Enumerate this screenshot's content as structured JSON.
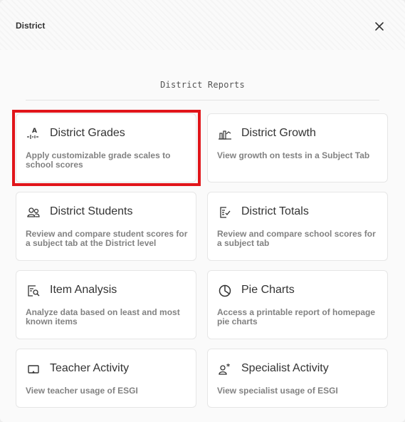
{
  "header": {
    "title": "District"
  },
  "section": {
    "title": "District Reports"
  },
  "cards": [
    {
      "title": "District Grades",
      "desc": "Apply customizable grade scales to school scores"
    },
    {
      "title": "District Growth",
      "desc": "View growth on tests in a Subject Tab"
    },
    {
      "title": "District Students",
      "desc": "Review and compare student scores for a subject tab at the District level"
    },
    {
      "title": "District Totals",
      "desc": "Review and compare school scores for a subject tab"
    },
    {
      "title": "Item Analysis",
      "desc": "Analyze data based on least and most known items"
    },
    {
      "title": "Pie Charts",
      "desc": "Access a printable report of homepage pie charts"
    },
    {
      "title": "Teacher Activity",
      "desc": "View teacher usage of ESGI"
    },
    {
      "title": "Specialist Activity",
      "desc": "View specialist usage of ESGI"
    }
  ],
  "icons": {
    "close": "close-icon",
    "grades": "grade-scale-icon",
    "growth": "growth-chart-icon",
    "students": "students-icon",
    "totals": "checklist-icon",
    "item_analysis": "document-search-icon",
    "pie_charts": "pie-chart-icon",
    "teacher_activity": "monitor-icon",
    "specialist_activity": "specialist-icon"
  },
  "colors": {
    "highlight": "#e1151a",
    "card_bg": "#ffffff",
    "desc_text": "#828282"
  }
}
